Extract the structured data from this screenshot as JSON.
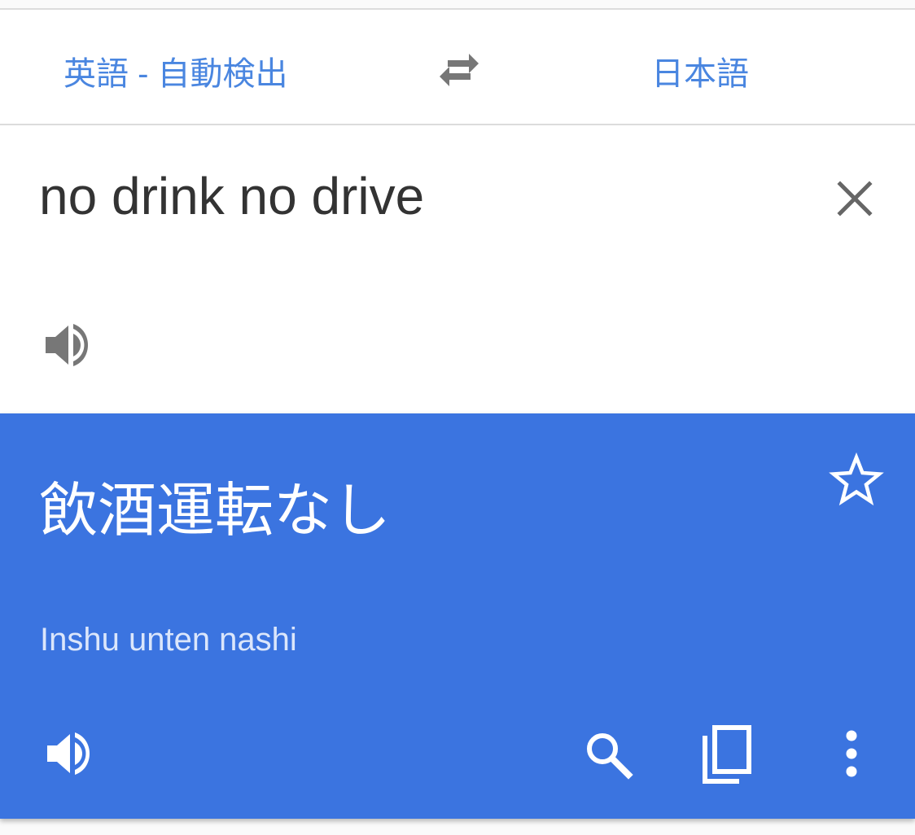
{
  "colors": {
    "accent": "#4a86e0",
    "result_background": "#3b74e0",
    "input_text": "#333333",
    "icon_gray": "#777777",
    "result_text": "#ffffff",
    "romanization_text": "#dbe6fb"
  },
  "language_bar": {
    "source_language": "英語 - 自動検出",
    "target_language": "日本語",
    "swap_icon": "swap-arrows-icon"
  },
  "input": {
    "text": "no drink no drive",
    "clear_icon": "close-icon",
    "speaker_icon": "speaker-icon"
  },
  "result": {
    "text": "飲酒運転なし",
    "romanization": "Inshu unten nashi",
    "star_icon": "star-outline-icon",
    "actions": [
      "speaker-icon",
      "search-icon",
      "copy-icon",
      "more-vert-icon"
    ]
  }
}
